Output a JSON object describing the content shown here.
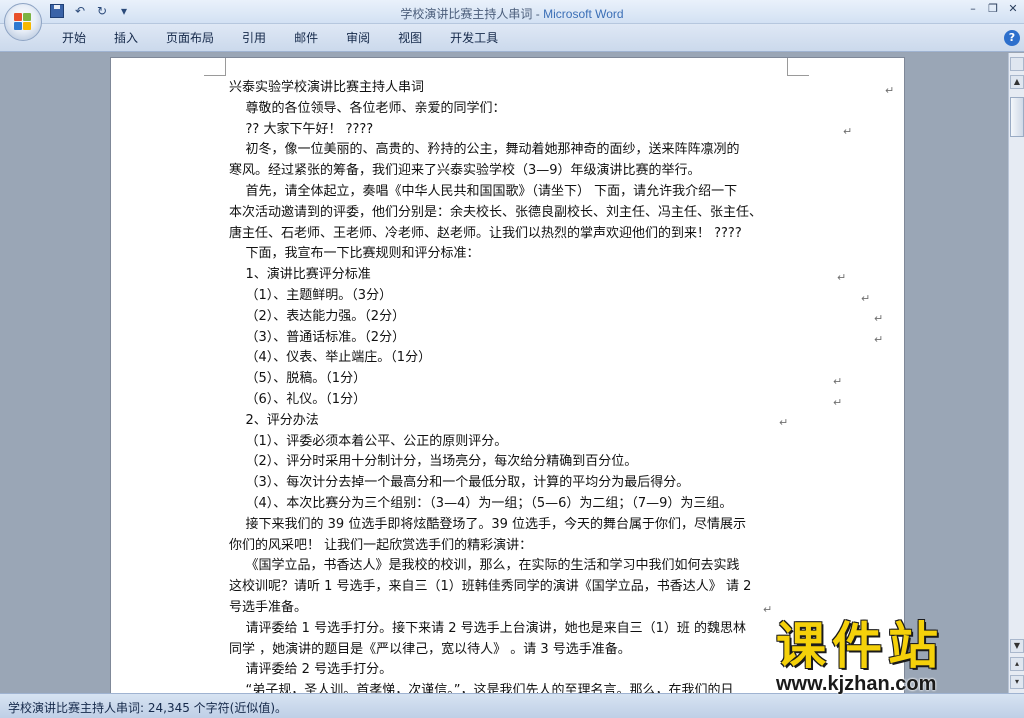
{
  "window": {
    "title_doc": "学校演讲比赛主持人串词",
    "title_sep": " - ",
    "title_app": "Microsoft Word",
    "minimize": "–",
    "restore": "❐",
    "close": "✕"
  },
  "qat": {
    "undo": "↶",
    "redo": "↻",
    "more": "▾"
  },
  "ribbon": {
    "tabs": [
      "开始",
      "插入",
      "页面布局",
      "引用",
      "邮件",
      "审阅",
      "视图",
      "开发工具"
    ],
    "help": "?"
  },
  "document": {
    "paragraph_mark": "↵",
    "lines": [
      "兴泰实验学校演讲比赛主持人串词",
      "    尊敬的各位领导、各位老师、亲爱的同学们：",
      "    ?? 大家下午好！ ????",
      "    初冬，像一位美丽的、高贵的、矜持的公主，舞动着她那神奇的面纱，送来阵阵凛冽的",
      "寒风。经过紧张的筹备，我们迎来了兴泰实验学校（3—9）年级演讲比赛的举行。",
      "    首先，请全体起立，奏唱《中华人民共和国国歌》（请坐下） 下面，请允许我介绍一下",
      "本次活动邀请到的评委，他们分别是：余夫校长、张德良副校长、刘主任、冯主任、张主任、",
      "唐主任、石老师、王老师、冷老师、赵老师。让我们以热烈的掌声欢迎他们的到来！ ????",
      "    下面，我宣布一下比赛规则和评分标准：",
      "    1、演讲比赛评分标准",
      "    （1）、主题鲜明。（3分）",
      "    （2）、表达能力强。（2分）",
      "    （3）、普通话标准。（2分）",
      "    （4）、仪表、举止端庄。（1分）",
      "    （5）、脱稿。（1分）",
      "    （6）、礼仪。（1分）",
      "    2、评分办法",
      "    （1）、评委必须本着公平、公正的原则评分。",
      "    （2）、评分时采用十分制计分，当场亮分，每次给分精确到百分位。",
      "    （3）、每次计分去掉一个最高分和一个最低分取，计算的平均分为最后得分。",
      "    （4）、本次比赛分为三个组别：（3—4）为一组；（5—6）为二组；（7—9）为三组。",
      "    接下来我们的 39 位选手即将炫酷登场了。39 位选手，今天的舞台属于你们，尽情展示",
      "你们的风采吧！ 让我们一起欣赏选手们的精彩演讲：",
      "    《国学立品，书香达人》是我校的校训，那么，在实际的生活和学习中我们如何去实践",
      "这校训呢？请听 1 号选手，来自三（1）班韩佳秀同学的演讲《国学立品，书香达人》 请 2",
      "号选手准备。",
      "    请评委给 1 号选手打分。接下来请 2 号选手上台演讲，她也是来自三（1）班 的魏思林",
      "同学 ，她演讲的题目是《严以律己，宽以待人》 。请 3 号选手准备。",
      "    请评委给 2 号选手打分。",
      "    “弟子规，圣人训。首孝悌，次谨信。”，这是我们先人的至理名言。那么，在我们的日"
    ]
  },
  "statusbar": {
    "text": "学校演讲比赛主持人串词: 24,345 个字符(近似值)。"
  },
  "watermark": {
    "brand": "课件站",
    "url": "www.kjzhan.com"
  }
}
